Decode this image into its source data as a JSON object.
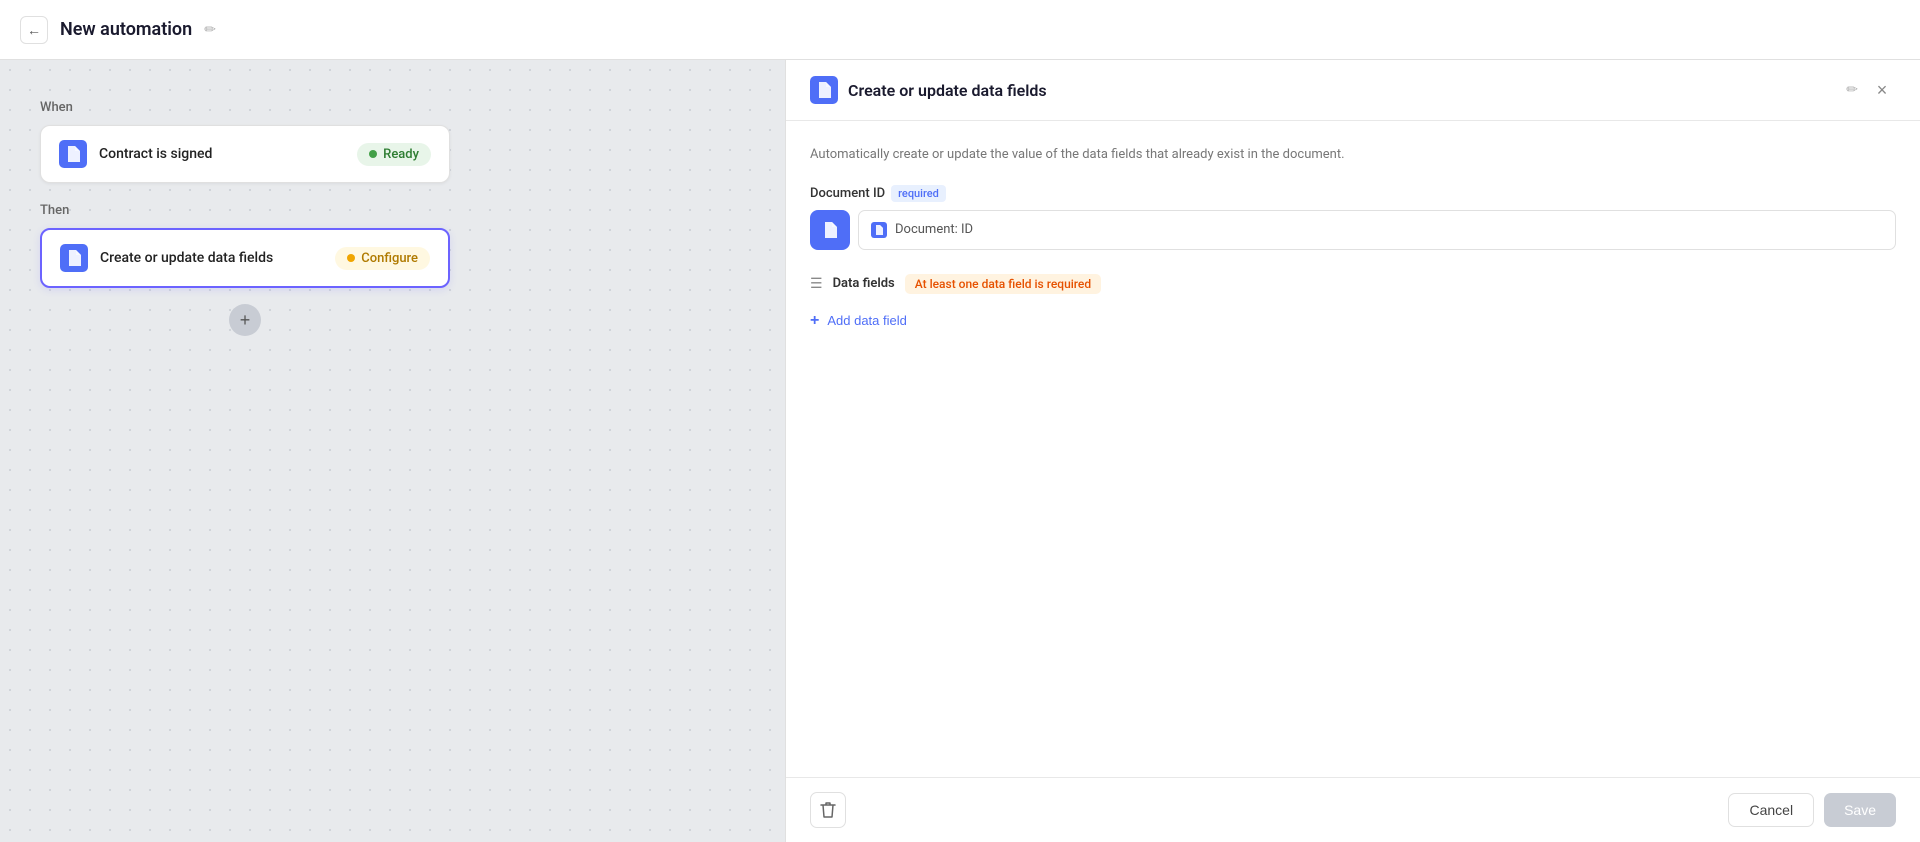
{
  "header": {
    "back_label": "←",
    "title": "New automation",
    "edit_icon": "✏"
  },
  "left_panel": {
    "when_label": "When",
    "then_label": "Then",
    "step1": {
      "icon": "📄",
      "name": "Contract is signed",
      "status": "Ready",
      "status_type": "ready"
    },
    "step2": {
      "icon": "📄",
      "name": "Create or update data fields",
      "status": "Configure",
      "status_type": "configure"
    },
    "add_step_icon": "+"
  },
  "right_panel": {
    "header": {
      "icon": "📄",
      "title": "Create or update data fields",
      "edit_icon": "✏",
      "close_icon": "×"
    },
    "description": "Automatically create or update the value of the data fields that already exist in the document.",
    "document_id": {
      "label": "Document ID",
      "required_label": "required",
      "value": "Document: ID"
    },
    "data_fields": {
      "section_title": "Data fields",
      "warning": "At least one data field is required",
      "add_label": "Add data field"
    },
    "footer": {
      "cancel_label": "Cancel",
      "save_label": "Save"
    }
  }
}
